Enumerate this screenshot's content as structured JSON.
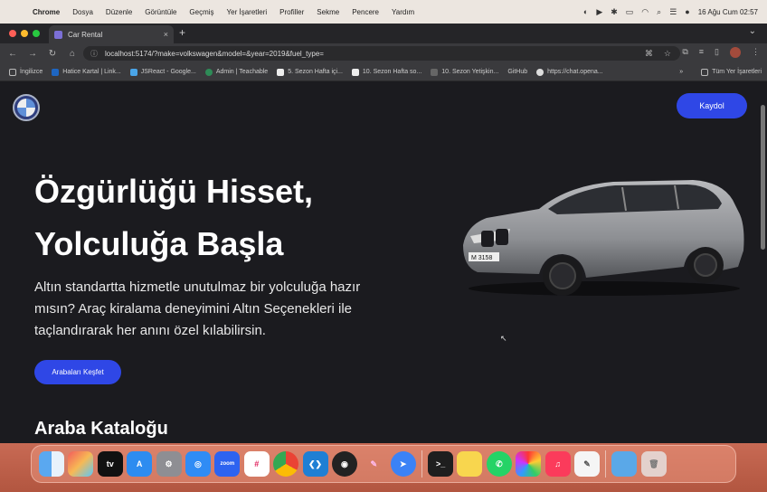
{
  "menubar": {
    "apple_icon": "apple-icon",
    "items": [
      "Chrome",
      "Dosya",
      "Düzenle",
      "Görüntüle",
      "Geçmiş",
      "Yer İşaretleri",
      "Profiller",
      "Sekme",
      "Pencere",
      "Yardım"
    ],
    "datetime": "16 Ağu Cum  02:57"
  },
  "tab": {
    "title": "Car Rental"
  },
  "address": {
    "url": "localhost:5174/?make=volkswagen&model=&year=2019&fuel_type="
  },
  "bookmarks": {
    "items": [
      "İngilizce",
      "Hatice Kartal | Link...",
      "JSReact - Google...",
      "Admin | Teachable",
      "5. Sezon Hafta içi...",
      "10. Sezon Hafta so...",
      "10. Sezon Yetişkin...",
      "GitHub",
      "https://chat.opena..."
    ],
    "overflow": "»",
    "all_bookmarks": "Tüm Yer İşaretleri"
  },
  "page": {
    "signup_button": "Kaydol",
    "hero_title_line1": "Özgürlüğü Hisset,",
    "hero_title_line2": "Yolculuğa Başla",
    "hero_description": "Altın standartta hizmetle unutulmaz bir yolculuğa hazır mısın? Araç kiralama deneyimini Altın Seçenekleri ile taçlandırarak her anını özel kılabilirsin.",
    "cta_button": "Arabaları Keşfet",
    "catalog_title": "Araba Kataloğu",
    "car_plate": "M 3158"
  },
  "dock": {
    "apps": [
      "finder",
      "launchpad",
      "apple-tv",
      "app-store",
      "system-settings",
      "safari",
      "zoom",
      "slack",
      "chrome",
      "vscode",
      "davinci",
      "pen-tool",
      "messenger",
      "terminal",
      "notes",
      "whatsapp",
      "colorpicker",
      "music",
      "textedit",
      "folder",
      "trash"
    ],
    "zoom_label": "zoom",
    "tv_label": "tv"
  }
}
